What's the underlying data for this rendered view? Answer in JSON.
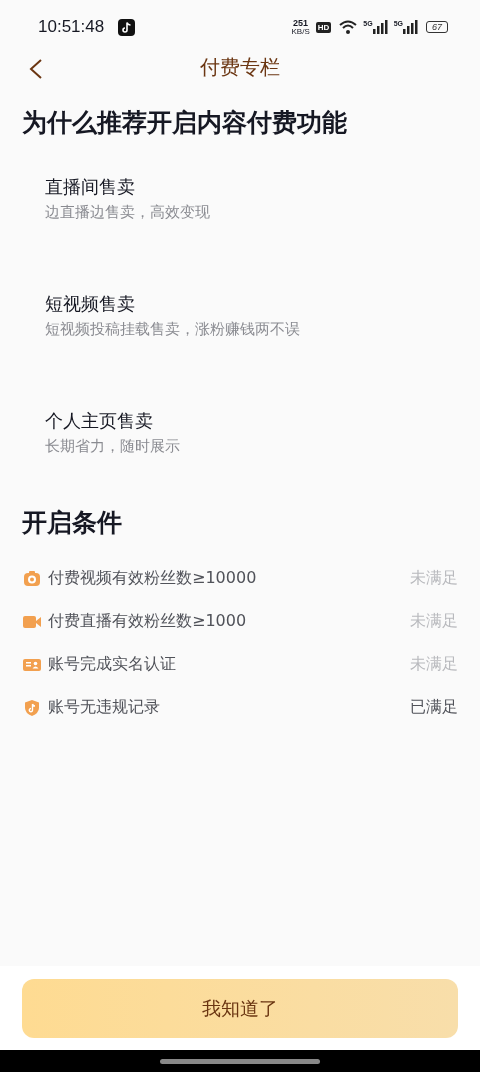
{
  "status_bar": {
    "time": "10:51:48",
    "speed_value": "251",
    "speed_unit": "KB/S",
    "hd": "HD",
    "signal_1": "5G",
    "signal_2": "5G",
    "battery": "67"
  },
  "header": {
    "title": "付费专栏"
  },
  "reasons": {
    "heading": "为什么推荐开启内容付费功能",
    "items": [
      {
        "title": "直播间售卖",
        "subtitle": "边直播边售卖，高效变现"
      },
      {
        "title": "短视频售卖",
        "subtitle": "短视频投稿挂载售卖，涨粉赚钱两不误"
      },
      {
        "title": "个人主页售卖",
        "subtitle": "长期省力，随时展示"
      }
    ]
  },
  "conditions": {
    "heading": "开启条件",
    "items": [
      {
        "kind": "camera",
        "label": "付费视频有效粉丝数≥10000",
        "status": "未满足",
        "met": false
      },
      {
        "kind": "video",
        "label": "付费直播有效粉丝数≥1000",
        "status": "未满足",
        "met": false
      },
      {
        "kind": "idcard",
        "label": "账号完成实名认证",
        "status": "未满足",
        "met": false
      },
      {
        "kind": "shield",
        "label": "账号无违规记录",
        "status": "已满足",
        "met": true
      }
    ]
  },
  "footer": {
    "button": "我知道了"
  }
}
